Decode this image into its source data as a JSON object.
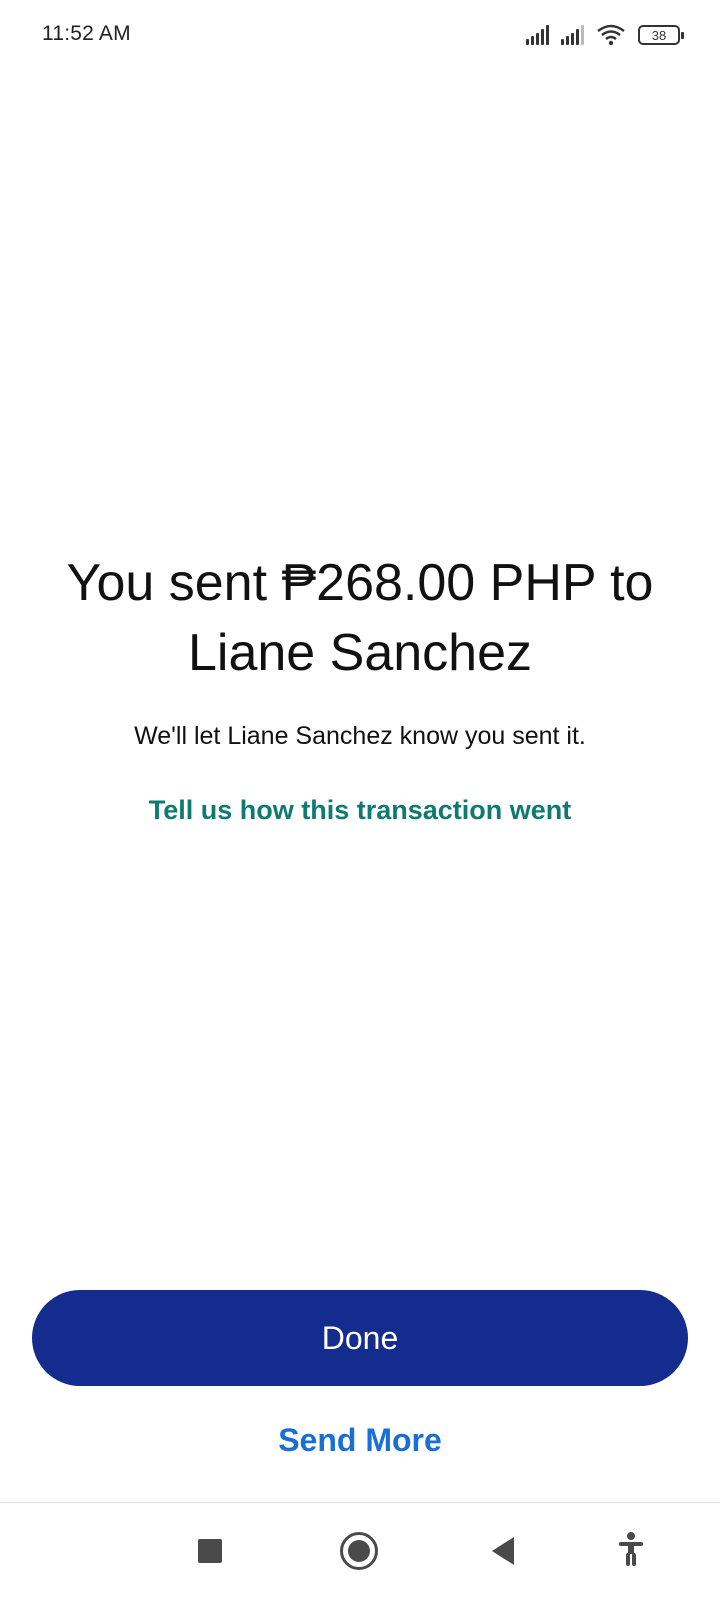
{
  "status_bar": {
    "time": "11:52 AM",
    "battery": "38"
  },
  "message": {
    "headline": "You sent ₱268.00 PHP to Liane Sanchez",
    "subtext": "We'll let Liane Sanchez know you sent it.",
    "feedback_link": "Tell us how this transaction went"
  },
  "actions": {
    "done_label": "Done",
    "send_more_label": "Send More"
  },
  "colors": {
    "done_button": "#142c8e",
    "send_more": "#1a6fd6",
    "feedback_link": "#0e7a70"
  },
  "nav_bar": {
    "icons": [
      "recents-square-icon",
      "home-circle-icon",
      "back-triangle-icon",
      "accessibility-icon"
    ]
  }
}
